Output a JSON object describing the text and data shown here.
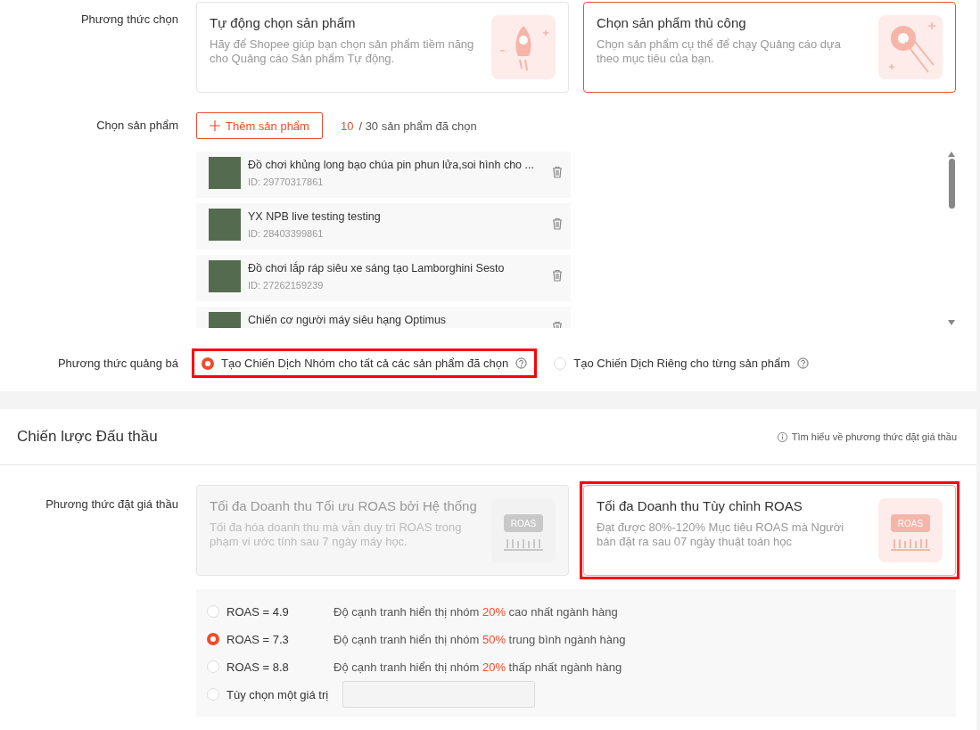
{
  "selection_method": {
    "label": "Phương thức chọn",
    "options": [
      {
        "title": "Tự động chọn sản phẩm",
        "description": "Hãy để Shopee giúp bạn chọn sản phẩm tiềm năng cho Quảng cáo Sản phẩm Tự động.",
        "selected": false
      },
      {
        "title": "Chọn sản phẩm thủ công",
        "description": "Chọn sản phẩm cụ thể để chạy Quảng cáo dựa theo mục tiêu của bạn.",
        "selected": true
      }
    ]
  },
  "product_picker": {
    "label": "Chọn sản phẩm",
    "add_button": "Thêm sản phẩm",
    "count": "10",
    "count_suffix": "/ 30 sản phẩm đã chọn",
    "products": [
      {
        "name": "Đồ chơi khủng long bạo chúa pin phun lửa,soi hình cho ...",
        "id": "ID: 29770317861"
      },
      {
        "name": "YX NPB live testing testing",
        "id": "ID: 28403399861"
      },
      {
        "name": "Đồ chơi lắp ráp siêu xe sáng tạo Lamborghini Sesto",
        "id": "ID: 27262159239"
      },
      {
        "name": "Chiến cơ người máy siêu hạng Optimus"
      }
    ]
  },
  "promotion_method": {
    "label": "Phương thức quảng bá",
    "options": [
      {
        "label": "Tạo Chiến Dịch Nhóm cho tất cả các sản phẩm đã chọn",
        "selected": true,
        "highlighted": true
      },
      {
        "label": "Tạo Chiến Dịch Riêng cho từng sản phẩm",
        "selected": false,
        "highlighted": false
      }
    ]
  },
  "bidding_strategy": {
    "title": "Chiến lược Đấu thầu",
    "help_link": "Tìm hiểu về phương thức đặt giá thầu",
    "label": "Phương thức đặt giá thầu",
    "options": [
      {
        "title": "Tối đa Doanh thu Tối ưu ROAS bởi Hệ thống",
        "description": "Tối đa hóa doanh thu mà vẫn duy trì ROAS trong phạm vi ước tính sau 7 ngày máy học.",
        "icon_label": "ROAS",
        "selected": false,
        "disabled": true,
        "highlighted": false
      },
      {
        "title": "Tối đa Doanh thu Tùy chỉnh ROAS",
        "description": "Đạt được 80%-120% Mục tiêu ROAS mà Người bán đặt ra sau 07 ngày thuật toán học",
        "icon_label": "ROAS",
        "selected": true,
        "disabled": false,
        "highlighted": true
      }
    ],
    "roas_options": [
      {
        "kind": "preset",
        "label": "ROAS = 4.9",
        "before": "Độ cạnh tranh hiển thị nhóm",
        "percent": "20%",
        "after": "cao nhất ngành hàng",
        "selected": false
      },
      {
        "kind": "preset",
        "label": "ROAS = 7.3",
        "before": "Độ cạnh tranh hiển thị nhóm",
        "percent": "50%",
        "after": "trung bình ngành hàng",
        "selected": true
      },
      {
        "kind": "preset",
        "label": "ROAS = 8.8",
        "before": "Độ cạnh tranh hiển thị nhóm",
        "percent": "20%",
        "after": "thấp nhất ngành hàng",
        "selected": false
      },
      {
        "kind": "custom",
        "label": "Tùy chọn một giá trị",
        "selected": false
      }
    ]
  }
}
